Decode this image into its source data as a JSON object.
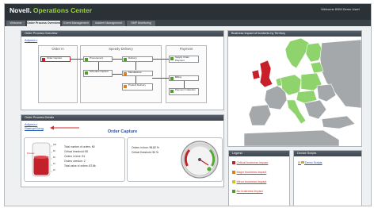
{
  "header": {
    "brand": "Novell.",
    "product": "Operations Center",
    "welcome": "Welcome BSM Demo User!"
  },
  "tabs": [
    {
      "label": "Welcome",
      "active": false
    },
    {
      "label": "Order Process Overview",
      "active": true
    },
    {
      "label": "Event Management",
      "active": false
    },
    {
      "label": "Incident Management",
      "active": false
    },
    {
      "label": "SMP Monitoring",
      "active": false
    }
  ],
  "overview": {
    "title": "Order Process Overview",
    "link": "Adjuma",
    "stages": [
      "Order In",
      "Speedy Delivery",
      "Payment"
    ],
    "nodes": {
      "order_capture": "Order Capture",
      "procurement": "Procurement",
      "delivery": "Delivery",
      "supply_chain": "Supply Chain Payment",
      "schedule_capture": "Schedule Capture",
      "manufacture": "Manufacture",
      "product_delivery": "Product Delivery",
      "billing": "Billing",
      "payment_collection": "Payment Collection"
    }
  },
  "map": {
    "title": "Business Impact of Incidents by Territory",
    "link": "Adjuma"
  },
  "details": {
    "title": "Order Process Details",
    "link1": "Adjuma",
    "link2": "Startup/Gong",
    "heading": "Order Capture",
    "tank_label": "Process",
    "tank_scale": [
      "100",
      "80",
      "60",
      "40",
      "20"
    ],
    "stats_left": [
      {
        "label": "Total number of orders",
        "value": "60"
      },
      {
        "label": "Critical threshold",
        "value": "50"
      },
      {
        "label": "Orders in time",
        "value": "91"
      },
      {
        "label": "Orders overdue",
        "value": "2"
      },
      {
        "label": "Total value of orders",
        "value": "87.6k"
      }
    ],
    "stats_right": [
      {
        "label": "Orders in time",
        "value": "95.82 %"
      },
      {
        "label": "Critical threshold",
        "value": "90 %"
      }
    ]
  },
  "legend": {
    "title": "Legend",
    "items": [
      {
        "label": "Critical business impact",
        "color": "#b3262a"
      },
      {
        "label": "Major business impact",
        "color": "#d9801f"
      },
      {
        "label": "Minor business impact",
        "color": "#d7c21c"
      },
      {
        "label": "No business impact",
        "color": "#4f9e2c"
      }
    ]
  },
  "device": {
    "title": "Device Scripts",
    "item": "Demo Scripts"
  },
  "colors": {
    "header": "#2a3238",
    "accent": "#9fcf3c",
    "critical": "#c8202a",
    "ok": "#8ed36b",
    "neutral": "#a5a8ab"
  }
}
